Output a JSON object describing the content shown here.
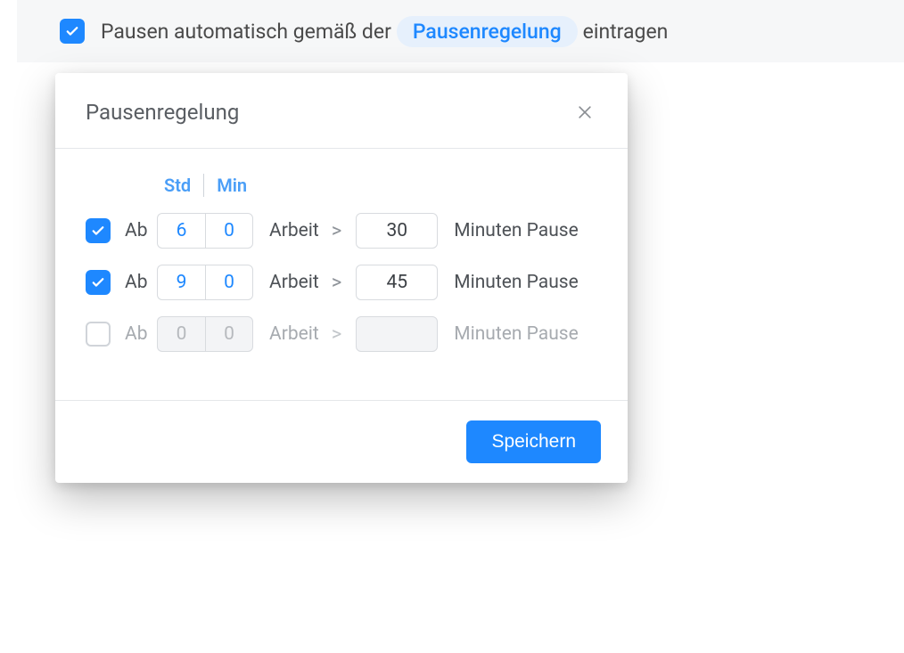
{
  "top": {
    "label_before": "Pausen automatisch gemäß der",
    "link_label": "Pausenregelung",
    "label_after": "eintragen",
    "checked": true
  },
  "modal": {
    "title": "Pausenregelung",
    "header": {
      "std": "Std",
      "min": "Min"
    },
    "labels": {
      "ab": "Ab",
      "arbeit": "Arbeit",
      "arrow": ">",
      "minuten_pause": "Minuten Pause"
    },
    "rules": [
      {
        "enabled": true,
        "hours": "6",
        "minutes": "0",
        "pause": "30"
      },
      {
        "enabled": true,
        "hours": "9",
        "minutes": "0",
        "pause": "45"
      },
      {
        "enabled": false,
        "hours": "0",
        "minutes": "0",
        "pause": ""
      }
    ],
    "save_label": "Speichern"
  }
}
